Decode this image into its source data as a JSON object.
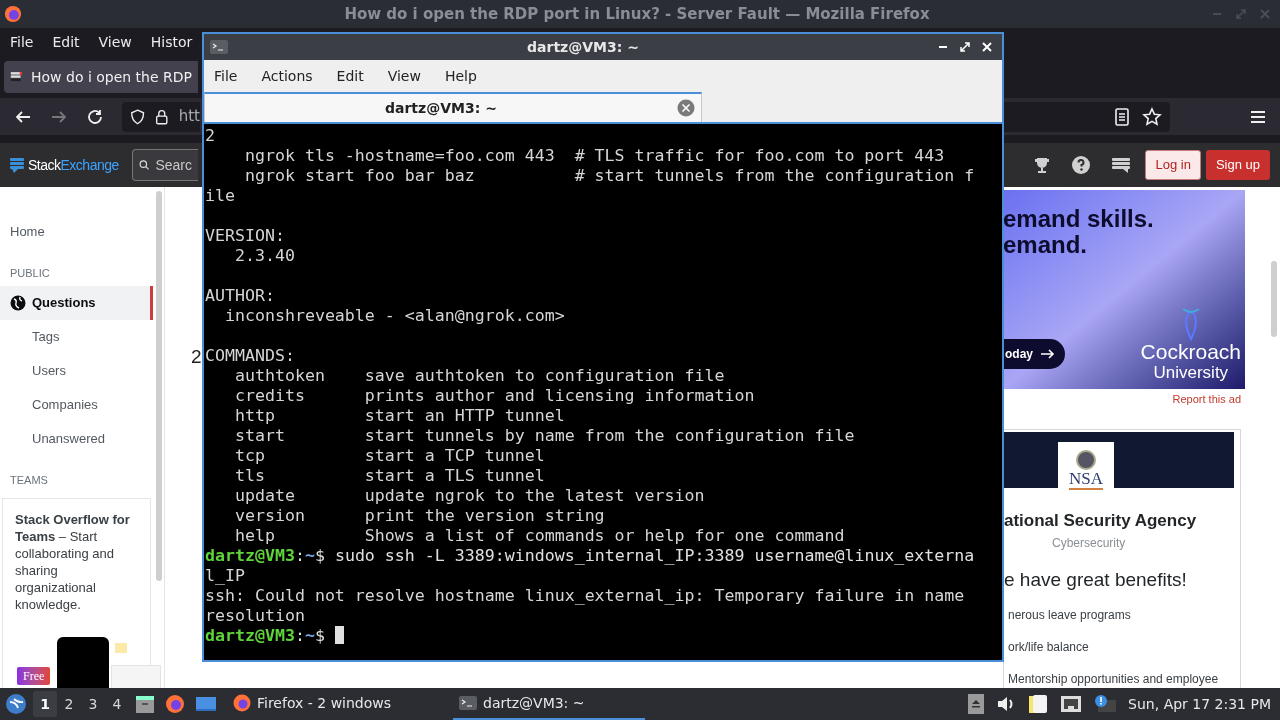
{
  "firefox": {
    "title": "How do i open the RDP port in Linux? - Server Fault — Mozilla Firefox",
    "menu": [
      "File",
      "Edit",
      "View",
      "Histor"
    ],
    "tab": {
      "title": "How do i open the RDP"
    },
    "url": "htt",
    "header": {
      "logo_left": "Stack",
      "logo_right": "Exchange",
      "search_placeholder": "Searc",
      "login": "Log in",
      "signup": "Sign up"
    },
    "sidebar": {
      "items": [
        {
          "kind": "link",
          "label": "Home",
          "selected": false
        },
        {
          "kind": "heading",
          "label": "PUBLIC"
        },
        {
          "kind": "icon_link",
          "label": "Questions",
          "selected": true
        },
        {
          "kind": "sublink",
          "label": "Tags",
          "selected": false
        },
        {
          "kind": "sublink",
          "label": "Users",
          "selected": false
        },
        {
          "kind": "sublink",
          "label": "Companies",
          "selected": false
        },
        {
          "kind": "sublink",
          "label": "Unanswered",
          "selected": false
        },
        {
          "kind": "heading",
          "label": "TEAMS"
        }
      ],
      "teams_card": {
        "text": "**Stack Overflow for Teams** – Start collaborating and sharing organizational knowledge.",
        "badge": "Free"
      }
    },
    "main_fragment": "2",
    "ads": {
      "banner": {
        "lines": [
          "emand skills.",
          "emand."
        ],
        "button": "oday",
        "brand": [
          "Cockroach",
          "University"
        ]
      },
      "report_link": "Report this ad",
      "company": {
        "logo_text": "NSA",
        "name": "ational Security Agency",
        "sector": "Cybersecurity",
        "headline": "e have great benefits!",
        "benefits": [
          "nerous leave programs",
          "ork/life balance",
          "Mentorship opportunities and employee"
        ]
      }
    }
  },
  "terminal": {
    "title": "dartz@VM3: ~",
    "menu": [
      "File",
      "Actions",
      "Edit",
      "View",
      "Help"
    ],
    "tab": {
      "title": "dartz@VM3: ~"
    },
    "lines": [
      {
        "kind": "text",
        "text": "2"
      },
      {
        "kind": "text",
        "text": "    ngrok tls -hostname=foo.com 443  # TLS traffic for foo.com to port 443"
      },
      {
        "kind": "text",
        "text": "    ngrok start foo bar baz          # start tunnels from the configuration f"
      },
      {
        "kind": "text",
        "text": "ile"
      },
      {
        "kind": "blank"
      },
      {
        "kind": "text",
        "text": "VERSION:"
      },
      {
        "kind": "text",
        "text": "   2.3.40"
      },
      {
        "kind": "blank"
      },
      {
        "kind": "text",
        "text": "AUTHOR:"
      },
      {
        "kind": "text",
        "text": "  inconshreveable - <alan@ngrok.com>"
      },
      {
        "kind": "blank"
      },
      {
        "kind": "text",
        "text": "COMMANDS:"
      },
      {
        "kind": "text",
        "text": "   authtoken    save authtoken to configuration file"
      },
      {
        "kind": "text",
        "text": "   credits      prints author and licensing information"
      },
      {
        "kind": "text",
        "text": "   http         start an HTTP tunnel"
      },
      {
        "kind": "text",
        "text": "   start        start tunnels by name from the configuration file"
      },
      {
        "kind": "text",
        "text": "   tcp          start a TCP tunnel"
      },
      {
        "kind": "text",
        "text": "   tls          start a TLS tunnel"
      },
      {
        "kind": "text",
        "text": "   update       update ngrok to the latest version"
      },
      {
        "kind": "text",
        "text": "   version      print the version string"
      },
      {
        "kind": "text",
        "text": "   help         Shows a list of commands or help for one command"
      },
      {
        "kind": "prompt",
        "segments": [
          {
            "kind": "user",
            "text": "dartz@VM3"
          },
          {
            "kind": "plain",
            "text": ":"
          },
          {
            "kind": "path",
            "text": "~"
          },
          {
            "kind": "plain",
            "text": "$ sudo ssh -L 3389:windows_internal_IP:3389 username@linux_externa"
          }
        ],
        "cursor": false
      },
      {
        "kind": "text",
        "text": "l_IP"
      },
      {
        "kind": "text",
        "text": "ssh: Could not resolve hostname linux_external_ip: Temporary failure in name"
      },
      {
        "kind": "text",
        "text": "resolution"
      },
      {
        "kind": "prompt",
        "segments": [
          {
            "kind": "user",
            "text": "dartz@VM3"
          },
          {
            "kind": "plain",
            "text": ":"
          },
          {
            "kind": "path",
            "text": "~"
          },
          {
            "kind": "plain",
            "text": "$"
          }
        ],
        "cursor": true
      }
    ]
  },
  "taskbar": {
    "workspaces": [
      {
        "label": "1",
        "selected": true
      },
      {
        "label": "2",
        "selected": false
      },
      {
        "label": "3",
        "selected": false
      },
      {
        "label": "4",
        "selected": false
      }
    ],
    "tasks": [
      {
        "kind": "browser",
        "label": "Firefox - 2 windows",
        "selected": false
      },
      {
        "kind": "terminal",
        "label": "dartz@VM3: ~",
        "selected": true
      }
    ],
    "clock": "Sun, Apr 17 2:31 PM"
  }
}
